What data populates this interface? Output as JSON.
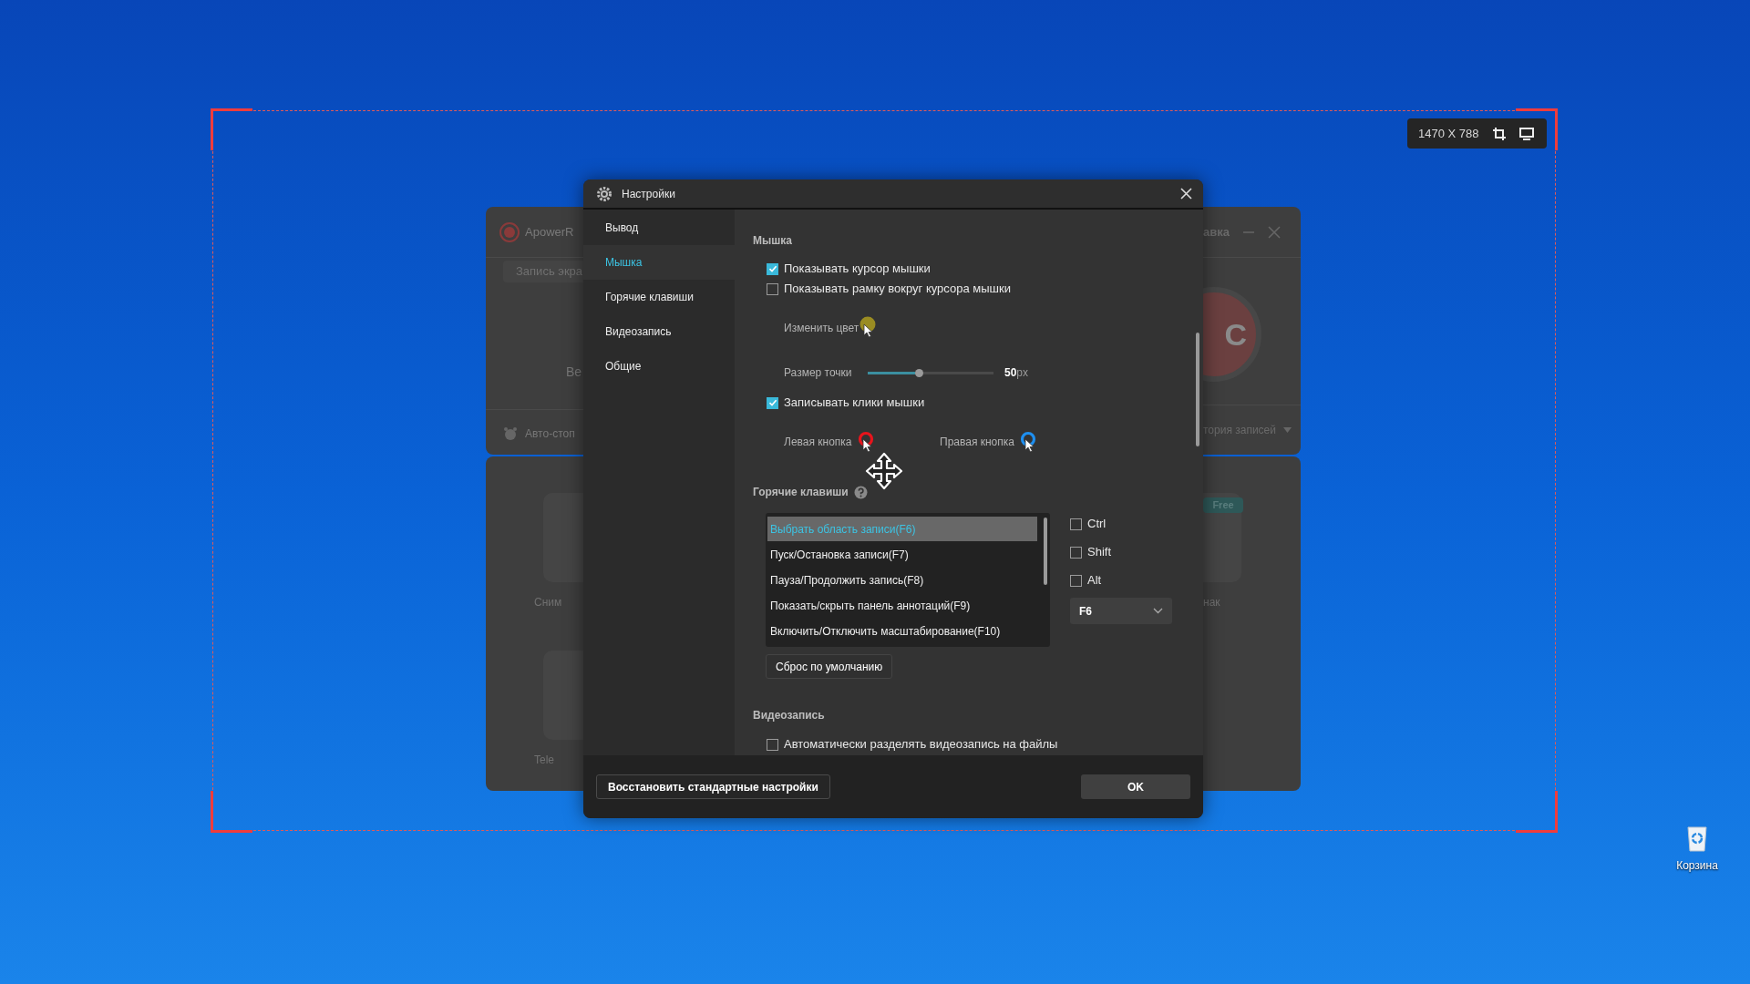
{
  "desktop": {
    "recycle_bin": {
      "label": "Корзина"
    }
  },
  "capture": {
    "size": "1470 X 788"
  },
  "background_app": {
    "title": "ApowerR",
    "tab": "Запись экра",
    "text_fragment": "Ве",
    "auto_stop": "Авто-стоп",
    "tile_label_1": "Сним",
    "tile_label_2": "Tele",
    "header_right": "авка",
    "record_label": "C",
    "history": "тория записей",
    "badge": "Free",
    "tile_label_3": "нак"
  },
  "settings_dialog": {
    "title": "Настройки",
    "sidebar": [
      {
        "label": "Вывод",
        "selected": false
      },
      {
        "label": "Мышка",
        "selected": true
      },
      {
        "label": "Горячие клавиши",
        "selected": false
      },
      {
        "label": "Видеозапись",
        "selected": false
      },
      {
        "label": "Общие",
        "selected": false
      }
    ],
    "mouse": {
      "heading": "Мышка",
      "show_cursor": {
        "label": "Показывать курсор мышки",
        "checked": true
      },
      "show_frame": {
        "label": "Показывать рамку вокруг курсора мышки",
        "checked": false
      },
      "change_color": {
        "label": "Изменить цвет",
        "color": "#9a8c22"
      },
      "dot_size": {
        "label": "Размер точки",
        "level": 0.38,
        "value": "50",
        "unit": "px"
      },
      "record_clicks": {
        "label": "Записывать клики мышки",
        "checked": true
      },
      "left_button": {
        "label": "Левая кнопка",
        "color": "#e8141c"
      },
      "right_button": {
        "label": "Правая кнопка",
        "color": "#1e8ff0"
      }
    },
    "hotkeys": {
      "heading": "Горячие клавиши",
      "actions": [
        {
          "label": "Выбрать область записи(F6)",
          "selected": true
        },
        {
          "label": "Пуск/Остановка записи(F7)",
          "selected": false
        },
        {
          "label": "Пауза/Продолжить запись(F8)",
          "selected": false
        },
        {
          "label": "Показать/скрыть панель аннотаций(F9)",
          "selected": false
        },
        {
          "label": "Включить/Отключить масштабирование(F10)",
          "selected": false
        }
      ],
      "modifiers": [
        {
          "label": "Ctrl",
          "checked": false
        },
        {
          "label": "Shift",
          "checked": false
        },
        {
          "label": "Alt",
          "checked": false
        }
      ],
      "key": "F6",
      "reset_button": "Сброс по умолчанию"
    },
    "video": {
      "heading": "Видеозапись",
      "split_files": {
        "label": "Автоматически разделять видеозапись на файлы",
        "checked": false
      }
    },
    "footer": {
      "restore_button": "Восстановить стандартные настройки",
      "ok_button": "OK"
    }
  }
}
